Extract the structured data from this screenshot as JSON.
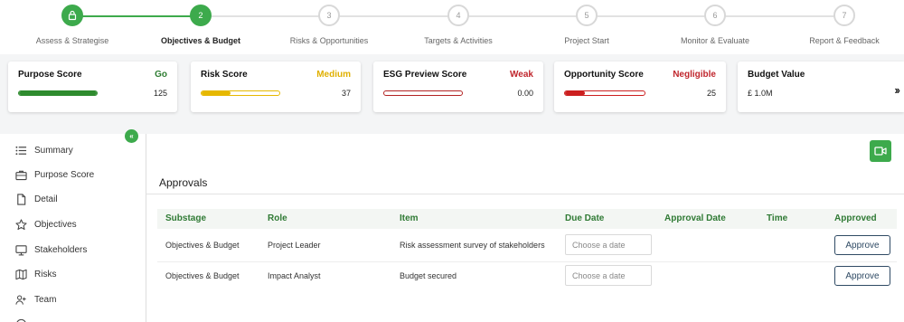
{
  "stepper": {
    "steps": [
      {
        "number": "",
        "label": "Assess & Strategise",
        "state": "done"
      },
      {
        "number": "2",
        "label": "Objectives & Budget",
        "state": "active"
      },
      {
        "number": "3",
        "label": "Risks & Opportunities",
        "state": "pending"
      },
      {
        "number": "4",
        "label": "Targets & Activities",
        "state": "pending"
      },
      {
        "number": "5",
        "label": "Project Start",
        "state": "pending"
      },
      {
        "number": "6",
        "label": "Monitor & Evaluate",
        "state": "pending"
      },
      {
        "number": "7",
        "label": "Report & Feedback",
        "state": "pending"
      }
    ]
  },
  "cards": {
    "purpose": {
      "title": "Purpose Score",
      "status": "Go",
      "value": "125",
      "fill_percent": 100,
      "color": "#2e8b2e"
    },
    "risk": {
      "title": "Risk Score",
      "status": "Medium",
      "value": "37",
      "fill_percent": 37,
      "color": "#e6b800"
    },
    "esg": {
      "title": "ESG Preview Score",
      "status": "Weak",
      "value": "0.00",
      "fill_percent": 0,
      "color": "#b22222"
    },
    "opportunity": {
      "title": "Opportunity Score",
      "status": "Negligible",
      "value": "25",
      "fill_percent": 25,
      "color": "#cc1f1f"
    },
    "budget": {
      "title": "Budget Value",
      "value": "£ 1.0M"
    }
  },
  "colors": {
    "accent": "#3daa4c",
    "header_text": "#2f7a34",
    "button_outline": "#2f4a64"
  },
  "sidebar": {
    "items": [
      {
        "label": "Summary",
        "icon": "list-icon"
      },
      {
        "label": "Purpose Score",
        "icon": "briefcase-icon"
      },
      {
        "label": "Detail",
        "icon": "document-icon"
      },
      {
        "label": "Objectives",
        "icon": "star-icon"
      },
      {
        "label": "Stakeholders",
        "icon": "monitor-icon"
      },
      {
        "label": "Risks",
        "icon": "map-icon"
      },
      {
        "label": "Team",
        "icon": "users-icon"
      }
    ]
  },
  "approvals": {
    "title": "Approvals",
    "columns": [
      "Substage",
      "Role",
      "Item",
      "Due Date",
      "Approval Date",
      "Time",
      "Approved"
    ],
    "date_placeholder": "Choose a date",
    "button_label": "Approve",
    "rows": [
      {
        "substage": "Objectives & Budget",
        "role": "Project Leader",
        "item": "Risk assessment survey of stakeholders",
        "approval_date": "",
        "time": ""
      },
      {
        "substage": "Objectives & Budget",
        "role": "Impact Analyst",
        "item": "Budget secured",
        "approval_date": "",
        "time": ""
      }
    ]
  }
}
